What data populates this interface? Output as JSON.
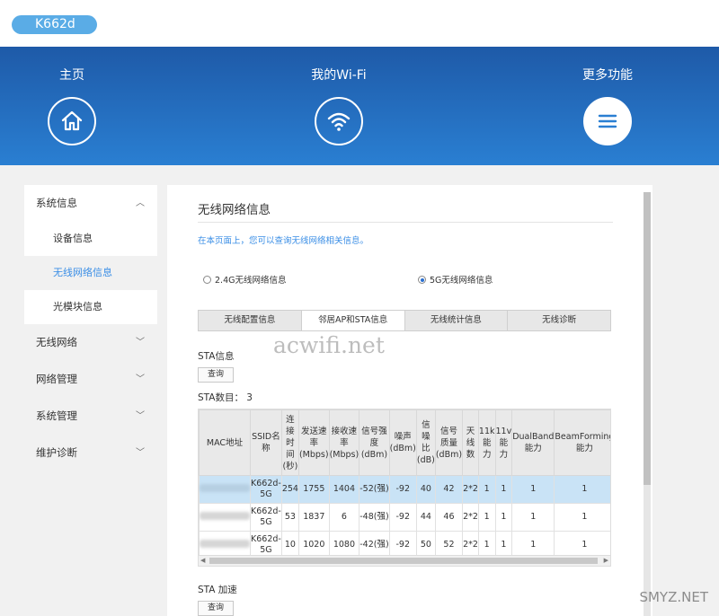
{
  "device": {
    "name": "K662d"
  },
  "nav": [
    {
      "label": "主页",
      "icon": "home-icon"
    },
    {
      "label": "我的Wi-Fi",
      "icon": "wifi-icon"
    },
    {
      "label": "更多功能",
      "icon": "menu-icon"
    }
  ],
  "sidebar": {
    "groups": [
      {
        "label": "系统信息",
        "expanded": true,
        "items": [
          "设备信息",
          "无线网络信息",
          "光模块信息"
        ],
        "active": "无线网络信息"
      },
      {
        "label": "无线网络"
      },
      {
        "label": "网络管理"
      },
      {
        "label": "系统管理"
      },
      {
        "label": "维护诊断"
      }
    ]
  },
  "main": {
    "title": "无线网络信息",
    "description": "在本页面上，您可以查询无线网络相关信息。",
    "radios": [
      {
        "label": "2.4G无线网络信息",
        "checked": false
      },
      {
        "label": "5G无线网络信息",
        "checked": true
      }
    ],
    "tabs": [
      "无线配置信息",
      "邻居AP和STA信息",
      "无线统计信息",
      "无线诊断"
    ],
    "active_tab": "邻居AP和STA信息",
    "watermark": "acwifi.net",
    "sta_info_title": "STA信息",
    "query_label": "查询",
    "sta_count_label": "STA数目：",
    "sta_count": "3",
    "table": {
      "headers": [
        "MAC地址",
        "SSID名称",
        "连接时间(秒)",
        "发送速率(Mbps)",
        "接收速率(Mbps)",
        "信号强度(dBm)",
        "噪声(dBm)",
        "信噪比(dB)",
        "信号质量(dBm)",
        "天线数",
        "11k能力",
        "11v能力",
        "DualBand能力",
        "BeamForming能力"
      ],
      "header_display": [
        [
          "MAC地址"
        ],
        [
          "SSID名",
          "称"
        ],
        [
          "连",
          "接",
          "时",
          "间",
          "(秒)"
        ],
        [
          "发送速",
          "率",
          "(Mbps)"
        ],
        [
          "接收速",
          "率",
          "(Mbps)"
        ],
        [
          "信号强",
          "度",
          "(dBm)"
        ],
        [
          "噪声",
          "(dBm)"
        ],
        [
          "信",
          "噪",
          "比",
          "(dB)"
        ],
        [
          "信号",
          "质量",
          "(dBm)"
        ],
        [
          "天",
          "线",
          "数"
        ],
        [
          "11k",
          "能",
          "力"
        ],
        [
          "11v",
          "能",
          "力"
        ],
        [
          "DualBand",
          "能力"
        ],
        [
          "BeamForming",
          "能力"
        ]
      ],
      "rows": [
        {
          "ssid": [
            "K662d-",
            "5G"
          ],
          "time": "254",
          "tx": "1755",
          "rx": "1404",
          "signal": "-52(强)",
          "noise": "-92",
          "snr": "40",
          "quality": "42",
          "ant": "2*2",
          "k11": "1",
          "v11": "1",
          "dual": "1",
          "bf": "1",
          "selected": true
        },
        {
          "ssid": [
            "K662d-",
            "5G"
          ],
          "time": "53",
          "tx": "1837",
          "rx": "6",
          "signal": "-48(强)",
          "noise": "-92",
          "snr": "44",
          "quality": "46",
          "ant": "2*2",
          "k11": "1",
          "v11": "1",
          "dual": "1",
          "bf": "1",
          "selected": false
        },
        {
          "ssid": [
            "K662d-",
            "5G"
          ],
          "time": "10",
          "tx": "1020",
          "rx": "1080",
          "signal": "-42(强)",
          "noise": "-92",
          "snr": "50",
          "quality": "52",
          "ant": "2*2",
          "k11": "1",
          "v11": "1",
          "dual": "1",
          "bf": "1",
          "selected": false
        }
      ]
    },
    "sta_speed_title": "STA 加速"
  },
  "corner_watermark": "SMYZ.NET"
}
